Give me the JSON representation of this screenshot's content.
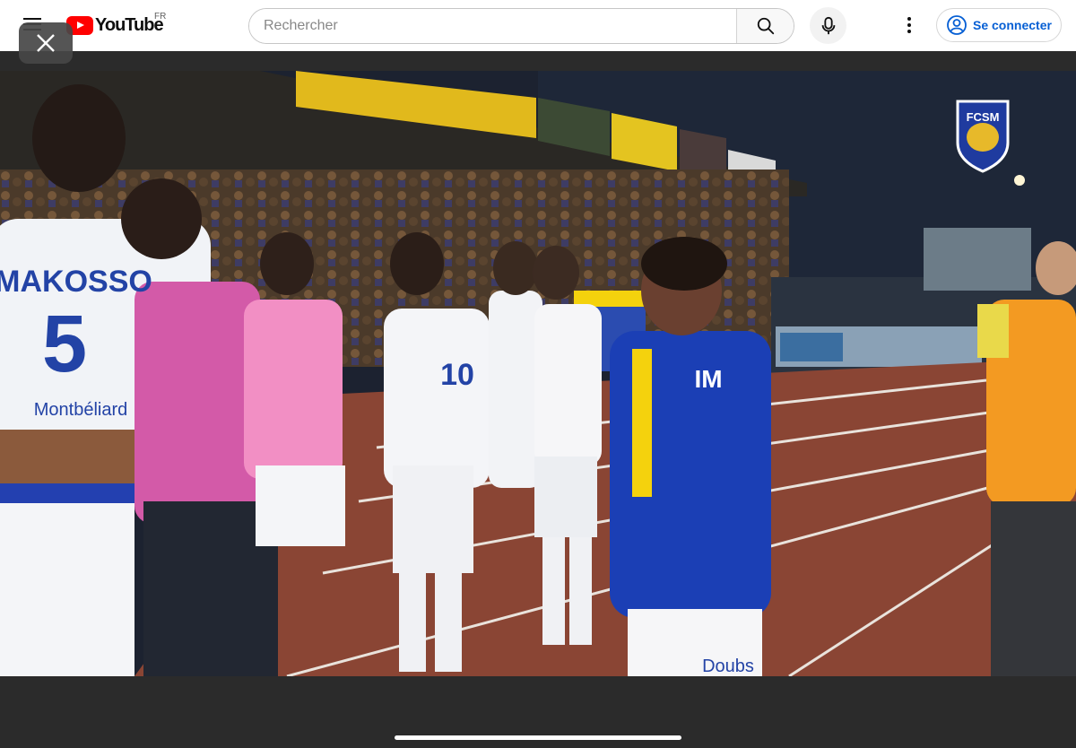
{
  "header": {
    "logo_text": "YouTube",
    "country_code": "FR",
    "search_placeholder": "Rechercher",
    "signin_label": "Se connecter"
  },
  "video": {
    "club_badge_text": "FCSM",
    "jersey_name": "MAKOSSO",
    "jersey_number": "5",
    "jersey_number_2": "10",
    "sponsor_text": "Montbéliard",
    "tracksuit_logo": "IM",
    "shorts_sponsor": "Doubs"
  },
  "colors": {
    "accent_red": "#ff0000",
    "link_blue": "#065fd4",
    "team_blue": "#1b3fb5",
    "team_yellow": "#f4d20d",
    "track_red": "#8a4534"
  }
}
